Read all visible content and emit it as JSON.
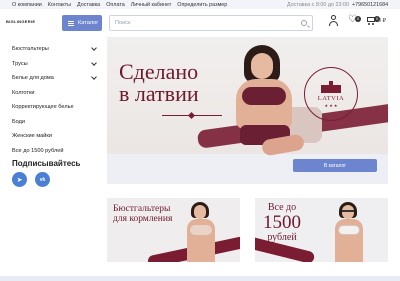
{
  "topbar": {
    "links": [
      "О компании",
      "Контакты",
      "Доставка",
      "Оплата",
      "Личный кабинет",
      "Определить размер"
    ],
    "hours": "Доставка с 8:00 до 23:00",
    "phone": "+79650121684"
  },
  "header": {
    "logo": "BIGLINGERIE",
    "catalog_label": "Каталог",
    "search_placeholder": "Поиск",
    "favorites_count": "0",
    "cart_count": "0",
    "cart_total": "0 ₽"
  },
  "sidebar": {
    "items": [
      {
        "label": "Бюстгальтеры",
        "has_submenu": true
      },
      {
        "label": "Трусы",
        "has_submenu": true
      },
      {
        "label": "Белье для дома",
        "has_submenu": true
      },
      {
        "label": "Колготки",
        "has_submenu": false
      },
      {
        "label": "Корректирующее белье",
        "has_submenu": false
      },
      {
        "label": "Боди",
        "has_submenu": false
      },
      {
        "label": "Женские майки",
        "has_submenu": false
      },
      {
        "label": "Все до 1500 рублей",
        "has_submenu": false
      }
    ],
    "subscribe_title": "Подписывайтесь",
    "socials": [
      {
        "icon": "telegram-icon",
        "glyph": "➤"
      },
      {
        "icon": "vk-icon",
        "glyph": "vk"
      }
    ]
  },
  "hero": {
    "title_line1": "Сделано",
    "title_line2": "в латвии",
    "badge_label": "LATVIA",
    "badge_stars": "★ ★ ★",
    "button_label": "В каталог"
  },
  "promos": [
    {
      "line1": "Бюстгальтеры",
      "line2": "для кормления"
    },
    {
      "line1": "Все до",
      "line2": "1500",
      "line3": "рублей"
    }
  ],
  "colors": {
    "accent": "#6d85cf",
    "brand_burgundy": "#7a1d33",
    "topbar_bg": "#f3f4f9"
  }
}
